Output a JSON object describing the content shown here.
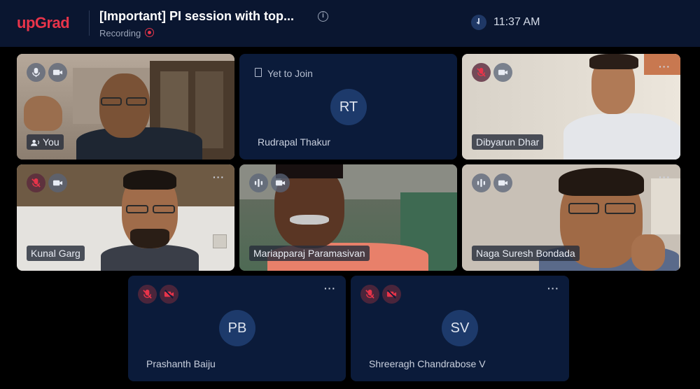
{
  "header": {
    "logo_text": "upGrad",
    "meeting_title": "[Important] PI session with top...",
    "recording_label": "Recording",
    "time": "11:37 AM"
  },
  "colors": {
    "brand": "#e8344a",
    "tile_bg": "#0b1b3a",
    "header_bg": "#0a1630"
  },
  "participants": [
    {
      "name": "You",
      "mic": "on",
      "camera": "on",
      "has_video": true
    },
    {
      "name": "Rudrapal Thakur",
      "status": "Yet to Join",
      "initials": "RT",
      "has_video": false
    },
    {
      "name": "Dibyarun Dhar",
      "mic": "muted",
      "camera": "on",
      "has_video": true
    },
    {
      "name": "Kunal Garg",
      "mic": "muted",
      "camera": "on",
      "has_video": true
    },
    {
      "name": "Mariapparaj Paramasivan",
      "mic": "speaking",
      "camera": "on",
      "has_video": true
    },
    {
      "name": "Naga Suresh Bondada",
      "mic": "speaking",
      "camera": "on",
      "has_video": true
    },
    {
      "name": "Prashanth Baiju",
      "initials": "PB",
      "mic": "muted",
      "camera": "off",
      "has_video": false
    },
    {
      "name": "Shreeragh Chandrabose V",
      "initials": "SV",
      "mic": "muted",
      "camera": "off",
      "has_video": false
    }
  ],
  "icons": [
    "mic-icon",
    "mic-muted-icon",
    "camera-icon",
    "camera-off-icon",
    "more-options-icon",
    "clock-icon",
    "info-icon",
    "recording-icon",
    "speaker-icon",
    "join-door-icon"
  ]
}
